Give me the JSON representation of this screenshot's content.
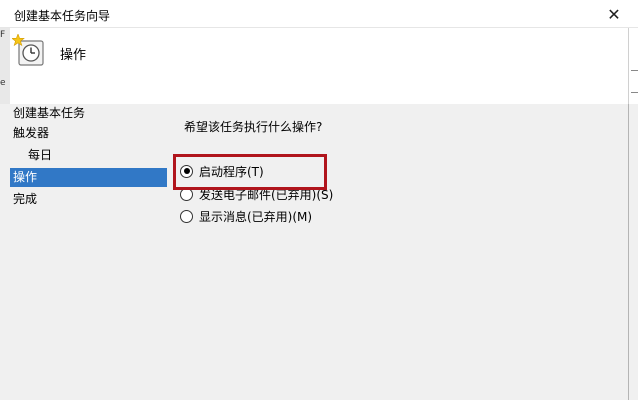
{
  "window": {
    "title": "创建基本任务向导",
    "close_label": "✕"
  },
  "header": {
    "title": "操作",
    "icon": "task-clock-icon"
  },
  "steps": [
    {
      "label": "创建基本任务"
    },
    {
      "label": "触发器"
    },
    {
      "label": "每日"
    },
    {
      "label": "操作"
    },
    {
      "label": "完成"
    }
  ],
  "active_step": "操作",
  "main": {
    "prompt": "希望该任务执行什么操作?",
    "options": [
      {
        "label": "启动程序(T)",
        "checked": true
      },
      {
        "label": "发送电子邮件(已弃用)(S)",
        "checked": false
      },
      {
        "label": "显示消息(已弃用)(M)",
        "checked": false
      }
    ]
  },
  "background_fragments": {
    "a": "F",
    "b": "e"
  },
  "colors": {
    "selected_step": "#3178c6",
    "highlight_box": "#b0141c"
  }
}
